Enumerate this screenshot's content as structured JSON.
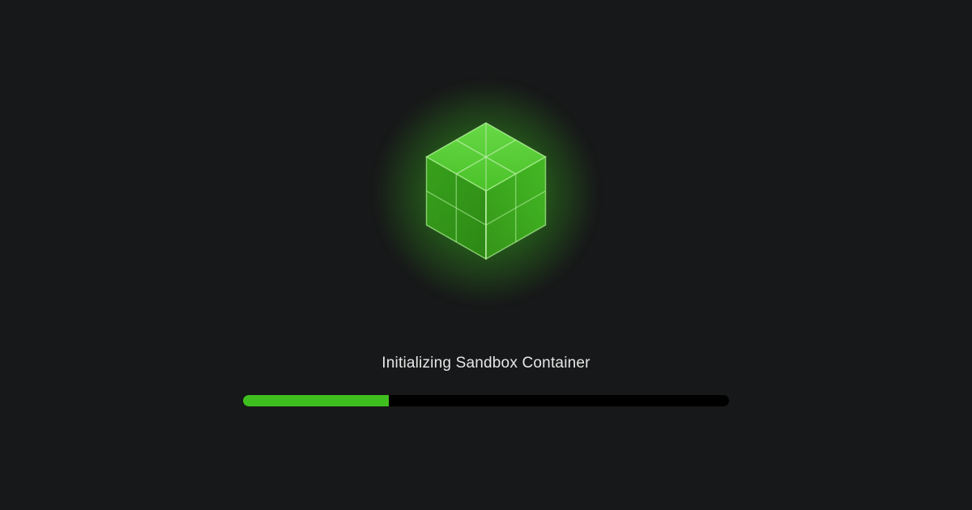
{
  "status_text": "Initializing Sandbox Container",
  "progress_percent": 30,
  "colors": {
    "accent": "#3fbf1f",
    "background": "#171819",
    "track": "#000000",
    "text": "#e6e6e6"
  }
}
